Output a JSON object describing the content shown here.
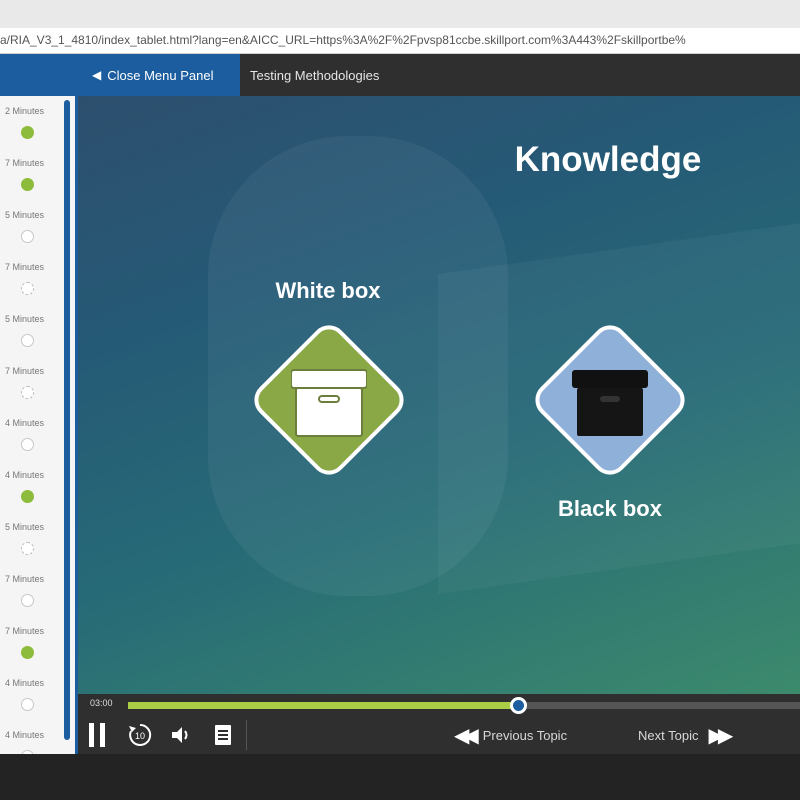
{
  "browser": {
    "url": "a/RIA_V3_1_4810/index_tablet.html?lang=en&AICC_URL=https%3A%2F%2Fpvsp81ccbe.skillport.com%3A443%2Fskillportbe%"
  },
  "header": {
    "close_menu_label": "Close Menu Panel",
    "topic_title": "Testing Methodologies"
  },
  "sidebar": {
    "items": [
      {
        "duration": "2 Minutes",
        "status": "done"
      },
      {
        "duration": "7 Minutes",
        "status": "done"
      },
      {
        "duration": "5 Minutes",
        "status": "open"
      },
      {
        "duration": "7 Minutes",
        "status": "dash"
      },
      {
        "duration": "5 Minutes",
        "status": "open"
      },
      {
        "duration": "7 Minutes",
        "status": "dash"
      },
      {
        "duration": "4 Minutes",
        "status": "open"
      },
      {
        "duration": "4 Minutes",
        "status": "done"
      },
      {
        "duration": "5 Minutes",
        "status": "dash"
      },
      {
        "duration": "7 Minutes",
        "status": "open"
      },
      {
        "duration": "7 Minutes",
        "status": "done"
      },
      {
        "duration": "4 Minutes",
        "status": "open"
      },
      {
        "duration": "4 Minutes",
        "status": "open"
      }
    ]
  },
  "slide": {
    "title": "Knowledge",
    "white_box_label": "White box",
    "black_box_label": "Black box"
  },
  "player": {
    "time": "03:00",
    "progress_fraction": 0.58,
    "previous_label": "Previous Topic",
    "next_label": "Next Topic",
    "icons": [
      "pause-icon",
      "replay-10-icon",
      "volume-icon",
      "transcript-icon",
      "previous-topic-icon",
      "next-topic-icon"
    ]
  },
  "colors": {
    "accent_blue": "#1b5d9f",
    "progress_green": "#a9cd45",
    "white_box_diamond": "#8aa845",
    "black_box_diamond": "#8fb0d8"
  }
}
